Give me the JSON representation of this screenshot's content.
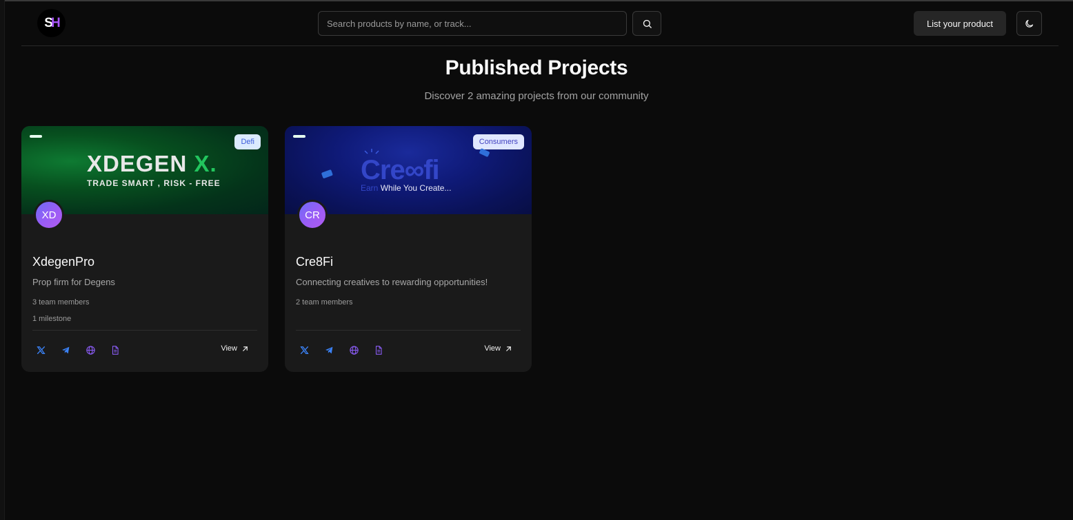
{
  "header": {
    "logo_text_1": "S",
    "logo_text_2": "H",
    "search_placeholder": "Search products by name, or track...",
    "list_button": "List your product"
  },
  "main": {
    "title": "Published Projects",
    "subtitle": "Discover 2 amazing projects from our community"
  },
  "projects": [
    {
      "name": "XdegenPro",
      "initials": "XD",
      "category": "Defi",
      "description": "Prop firm for Degens",
      "team": "3 team members",
      "milestones": "1 milestone",
      "banner_title": "XDEGEN",
      "banner_title_accent": "X.",
      "banner_tagline": "TRADE SMART , RISK - FREE",
      "view_label": "View"
    },
    {
      "name": "Cre8Fi",
      "initials": "CR",
      "category": "Consumers",
      "description": "Connecting creatives to rewarding opportunities!",
      "team": "2 team members",
      "banner_title": "Cre∞fi",
      "banner_tagline_accent": "Earn",
      "banner_tagline": " While You Create...",
      "view_label": "View"
    }
  ],
  "colors": {
    "background": "#0b0b0b",
    "card": "#1a1a1a",
    "accent_purple": "#a855f7",
    "twitter": "#3b82f6",
    "telegram": "#3b82f6",
    "website": "#8b5cf6",
    "docs": "#8b5cf6"
  }
}
